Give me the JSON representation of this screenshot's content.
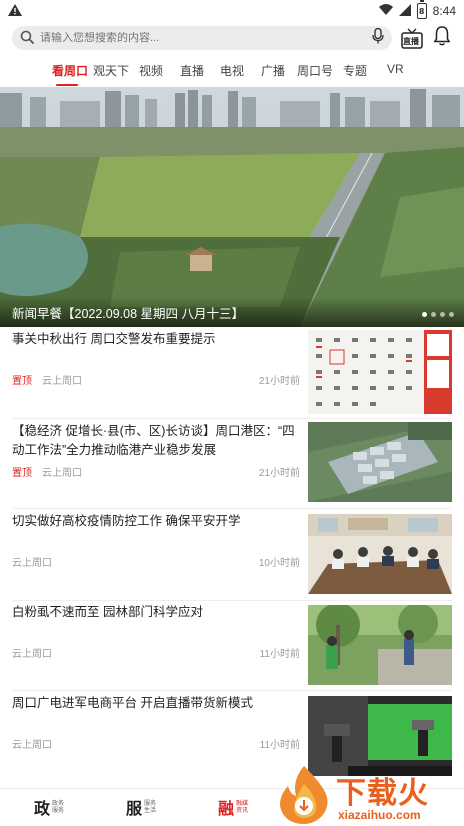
{
  "status_bar": {
    "time": "8:44",
    "battery": "8",
    "icons": [
      "alert-icon",
      "wifi-icon",
      "signal-icon",
      "battery-icon"
    ]
  },
  "search": {
    "placeholder": "请输入您想搜索的内容...",
    "tv_label": "直播",
    "icons": [
      "search-icon",
      "mic-icon",
      "tv-icon",
      "bell-icon"
    ]
  },
  "tabs": [
    {
      "label": "看周口",
      "active": true
    },
    {
      "label": "观天下",
      "active": false
    },
    {
      "label": "视频",
      "active": false
    },
    {
      "label": "直播",
      "active": false
    },
    {
      "label": "电视",
      "active": false
    },
    {
      "label": "广播",
      "active": false
    },
    {
      "label": "周口号",
      "active": false
    },
    {
      "label": "专题",
      "active": false
    },
    {
      "label": "VR",
      "active": false
    }
  ],
  "banner": {
    "caption": "新闻早餐【2022.09.08 星期四 八月十三】",
    "dots": 4,
    "active_dot": 0
  },
  "news": [
    {
      "title": "事关中秋出行 周口交警发布重要提示",
      "pin": "置顶",
      "source": "云上周口",
      "time": "21小时前",
      "thumb": "calendar"
    },
    {
      "title": "【稳经济 促增长·县(市、区)长访谈】周口港区：“四动工作法”全力推动临港产业稳步发展",
      "pin": "置顶",
      "source": "云上周口",
      "time": "21小时前",
      "thumb": "aerial-port"
    },
    {
      "title": "切实做好高校疫情防控工作 确保平安开学",
      "pin": "",
      "source": "云上周口",
      "time": "10小时前",
      "thumb": "meeting"
    },
    {
      "title": "白粉虱不速而至 园林部门科学应对",
      "pin": "",
      "source": "云上周口",
      "time": "11小时前",
      "thumb": "park"
    },
    {
      "title": "周口广电进军电商平台 开启直播带货新模式",
      "pin": "",
      "source": "云上周口",
      "time": "11小时前",
      "thumb": "studio"
    }
  ],
  "bottom_nav": [
    {
      "big": "政",
      "small1": "政务",
      "small2": "服务",
      "active": false
    },
    {
      "big": "服",
      "small1": "服务",
      "small2": "生活",
      "active": false
    },
    {
      "big": "融",
      "small1": "融媒",
      "small2": "资讯",
      "active": true
    }
  ],
  "watermark": {
    "text": "下载火",
    "url": "xiazaihuo.com"
  },
  "colors": {
    "accent": "#e02020",
    "watermark": "#e8601e"
  }
}
